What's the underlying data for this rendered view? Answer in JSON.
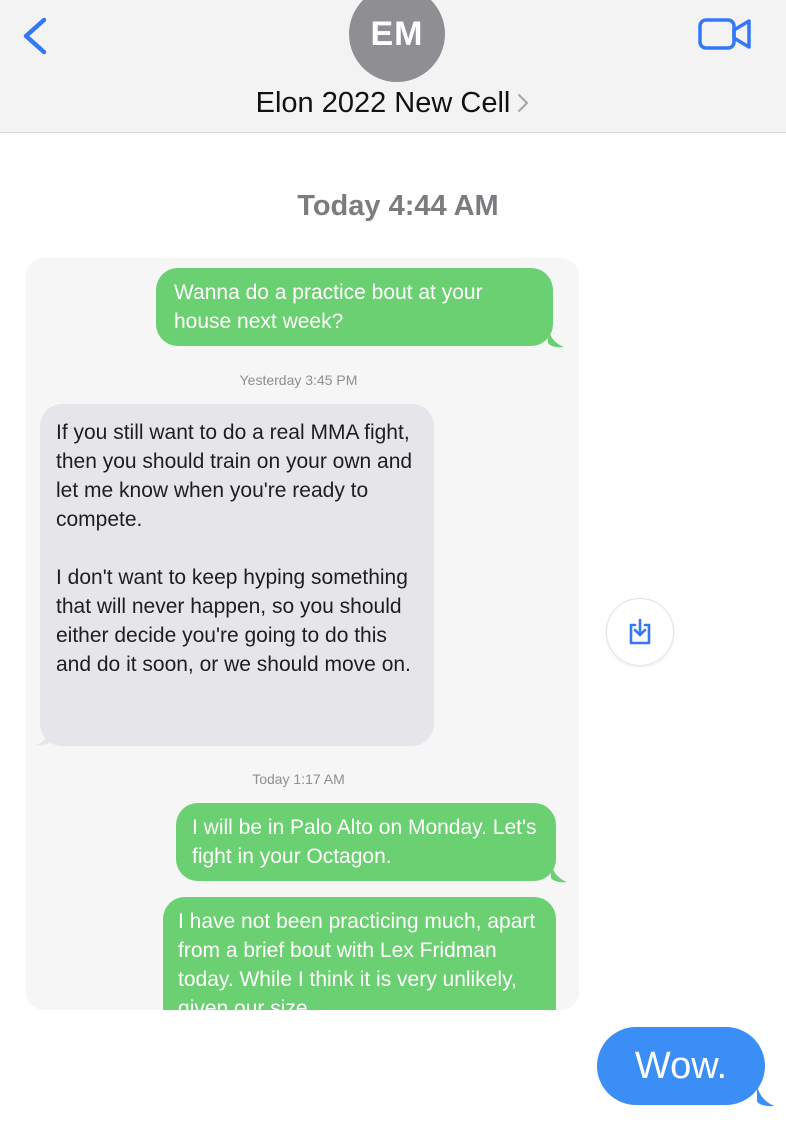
{
  "header": {
    "back_icon": "chevron-left-icon",
    "avatar_initials": "EM",
    "contact_name": "Elon 2022 New Cell",
    "video_icon": "video-camera-icon",
    "accent_color": "#3478f6"
  },
  "conversation": {
    "timestamp": "Today 4:44 AM",
    "screenshot": {
      "messages": [
        {
          "type": "sent",
          "text": "Wanna do a practice bout at your house next week?"
        },
        {
          "type": "timestamp",
          "text": "Yesterday 3:45 PM"
        },
        {
          "type": "received",
          "paragraphs": [
            "If you still want to do a real MMA fight, then you should train on your own and let me know when you're ready to compete.",
            "I don't want to keep hyping something that will never happen, so you should either decide you're going to do this and do it soon, or we should move on."
          ]
        },
        {
          "type": "timestamp",
          "text": "Today 1:17 AM"
        },
        {
          "type": "sent",
          "text": "I will be in Palo Alto on Monday. Let's fight in your Octagon."
        },
        {
          "type": "sent",
          "text": "I have not been practicing much, apart from a brief bout with Lex Fridman today. While I think it is very unlikely, given our size"
        }
      ],
      "sent_color": "#6bd071",
      "received_color": "#e6e6ea"
    },
    "save_icon": "save-to-photos-icon",
    "reply": {
      "text": "Wow.",
      "color": "#3a8ef6"
    }
  }
}
